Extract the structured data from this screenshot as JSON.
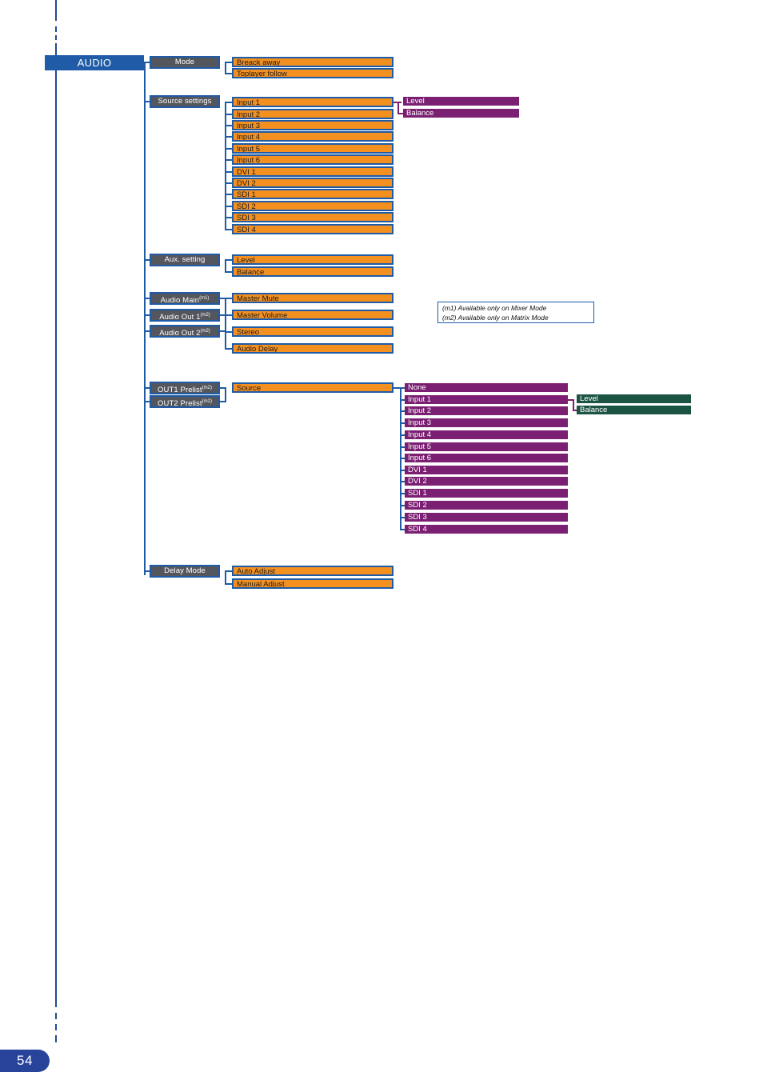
{
  "page": {
    "number": "54"
  },
  "root": {
    "label": "AUDIO"
  },
  "sections": {
    "mode": {
      "label": "Mode",
      "items": [
        {
          "label": "Breack away"
        },
        {
          "label": "Toplayer follow"
        }
      ]
    },
    "source_settings": {
      "label": "Source settings",
      "items": [
        {
          "label": "Input 1"
        },
        {
          "label": "Input 2"
        },
        {
          "label": "Input 3"
        },
        {
          "label": "Input 4"
        },
        {
          "label": "Input 5"
        },
        {
          "label": "Input 6"
        },
        {
          "label": "DVI 1"
        },
        {
          "label": "DVI 2"
        },
        {
          "label": "SDI 1"
        },
        {
          "label": "SDI 2"
        },
        {
          "label": "SDI 3"
        },
        {
          "label": "SDI 4"
        }
      ],
      "sub_items": [
        {
          "label": "Level"
        },
        {
          "label": "Balance"
        }
      ]
    },
    "aux_setting": {
      "label": "Aux. setting",
      "items": [
        {
          "label": "Level"
        },
        {
          "label": "Balance"
        }
      ]
    },
    "audio_group": {
      "boxes": [
        {
          "label": "Audio Main",
          "note": "(m1)"
        },
        {
          "label": "Audio Out 1",
          "note": "(m2)"
        },
        {
          "label": "Audio Out 2",
          "note": "(m2)"
        }
      ],
      "items": [
        {
          "label": "Master Mute"
        },
        {
          "label": "Master Volume"
        },
        {
          "label": "Stereo"
        },
        {
          "label": "Audio Delay"
        }
      ]
    },
    "prelist": {
      "boxes": [
        {
          "label": "OUT1 Prelist",
          "note": "(m2)"
        },
        {
          "label": "OUT2 Prelist",
          "note": "(m2)"
        }
      ],
      "source": {
        "label": "Source"
      },
      "sources": [
        {
          "label": "None"
        },
        {
          "label": "Input 1"
        },
        {
          "label": "Input 2"
        },
        {
          "label": "Input 3"
        },
        {
          "label": "Input 4"
        },
        {
          "label": "Input 5"
        },
        {
          "label": "Input 6"
        },
        {
          "label": "DVI 1"
        },
        {
          "label": "DVI 2"
        },
        {
          "label": "SDI 1"
        },
        {
          "label": "SDI 2"
        },
        {
          "label": "SDI 3"
        },
        {
          "label": "SDI 4"
        }
      ],
      "sub_items": [
        {
          "label": "Level"
        },
        {
          "label": "Balance"
        }
      ]
    },
    "delay_mode": {
      "label": "Delay Mode",
      "items": [
        {
          "label": "Auto Adjust"
        },
        {
          "label": "Manual Adjust"
        }
      ]
    }
  },
  "legend": {
    "lines": [
      "(m1) Available only on Mixer Mode",
      "(m2) Available only on Matrix Mode"
    ]
  }
}
